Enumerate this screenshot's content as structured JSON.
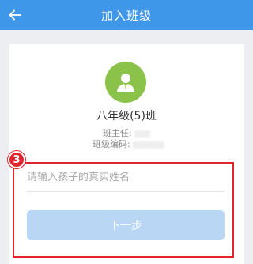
{
  "header": {
    "title": "加入班级",
    "back_icon": "arrow-left-icon",
    "background": "#3e97e8"
  },
  "class_card": {
    "avatar_icon": "user-avatar-icon",
    "avatar_color": "#8bc34a",
    "class_name": "八年级(5)班",
    "teacher_label": "班主任:",
    "code_label": "班级编码:"
  },
  "form": {
    "step_number": "3",
    "name_placeholder": "请输入孩子的真实姓名",
    "name_value": "",
    "next_label": "下一步",
    "highlight_color": "#e1242d"
  }
}
